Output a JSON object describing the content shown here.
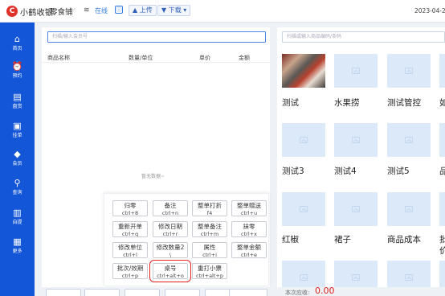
{
  "header": {
    "logo_glyph": "C",
    "app_title": "小鹤收银",
    "shop_name": "零食铺",
    "status_text": "在线",
    "status_icon": "ⓘ",
    "upload_label": "上传",
    "download_label": "下载",
    "date": "2023-04-2"
  },
  "sidebar": {
    "items": [
      {
        "label": "首页",
        "icon": "home-icon",
        "glyph": "⌂"
      },
      {
        "label": "预约",
        "icon": "clock-icon",
        "glyph": "⏰"
      },
      {
        "label": "盘货",
        "icon": "document-icon",
        "glyph": "▤"
      },
      {
        "label": "挂单",
        "icon": "order-icon",
        "glyph": "▣"
      },
      {
        "label": "会员",
        "icon": "diamond-icon",
        "glyph": "◆"
      },
      {
        "label": "查询",
        "icon": "search-icon",
        "glyph": "⚲"
      },
      {
        "label": "自提",
        "icon": "bag-icon",
        "glyph": "▥"
      },
      {
        "label": "更多",
        "icon": "grid-icon",
        "glyph": "▦"
      }
    ]
  },
  "order": {
    "search_placeholder": "扫描/输入会员号",
    "columns": [
      "商品名称",
      "数量/单位",
      "单价",
      "金额"
    ],
    "empty_text": "暂无数据~"
  },
  "keypad": {
    "keys": [
      {
        "label": "归零",
        "shortcut": "ctrl+8"
      },
      {
        "label": "备注",
        "shortcut": "ctrl+n"
      },
      {
        "label": "整单打折",
        "shortcut": "f4"
      },
      {
        "label": "整单赠送",
        "shortcut": "ctrl+u"
      },
      {
        "label": "重新开单",
        "shortcut": "ctrl+q"
      },
      {
        "label": "修改日期",
        "shortcut": "ctrl+r"
      },
      {
        "label": "整单备注",
        "shortcut": "ctrl+m"
      },
      {
        "label": "抹零",
        "shortcut": "ctrl+x"
      },
      {
        "label": "修改单位",
        "shortcut": "ctrl+l"
      },
      {
        "label": "修改数量2",
        "shortcut": "\\"
      },
      {
        "label": "属性",
        "shortcut": "ctrl+i"
      },
      {
        "label": "整单金额",
        "shortcut": "ctrl+e"
      },
      {
        "label": "批次/效期",
        "shortcut": "ctrl+p"
      },
      {
        "label": "桌号",
        "shortcut": "ctrl+alt+o"
      },
      {
        "label": "重打小票",
        "shortcut": "ctrl+alt+p"
      }
    ],
    "selected_key": "桌号"
  },
  "products": {
    "search_placeholder": "扫描或输入商品编码/条码",
    "items": [
      "测试",
      "水果捞",
      "测试管控",
      "如",
      "测试3",
      "测试4",
      "测试5",
      "品",
      "红椒",
      "裙子",
      "商品成本",
      "批"
    ],
    "item_last_row_extra": "价"
  },
  "footer": {
    "total_label": "本次应收:",
    "total_value": "0.00"
  },
  "colors": {
    "sidebar": "#1456d8",
    "accent": "#2f7de1",
    "selected_outline": "#e0261f",
    "card_placeholder": "#dbe9f9"
  }
}
